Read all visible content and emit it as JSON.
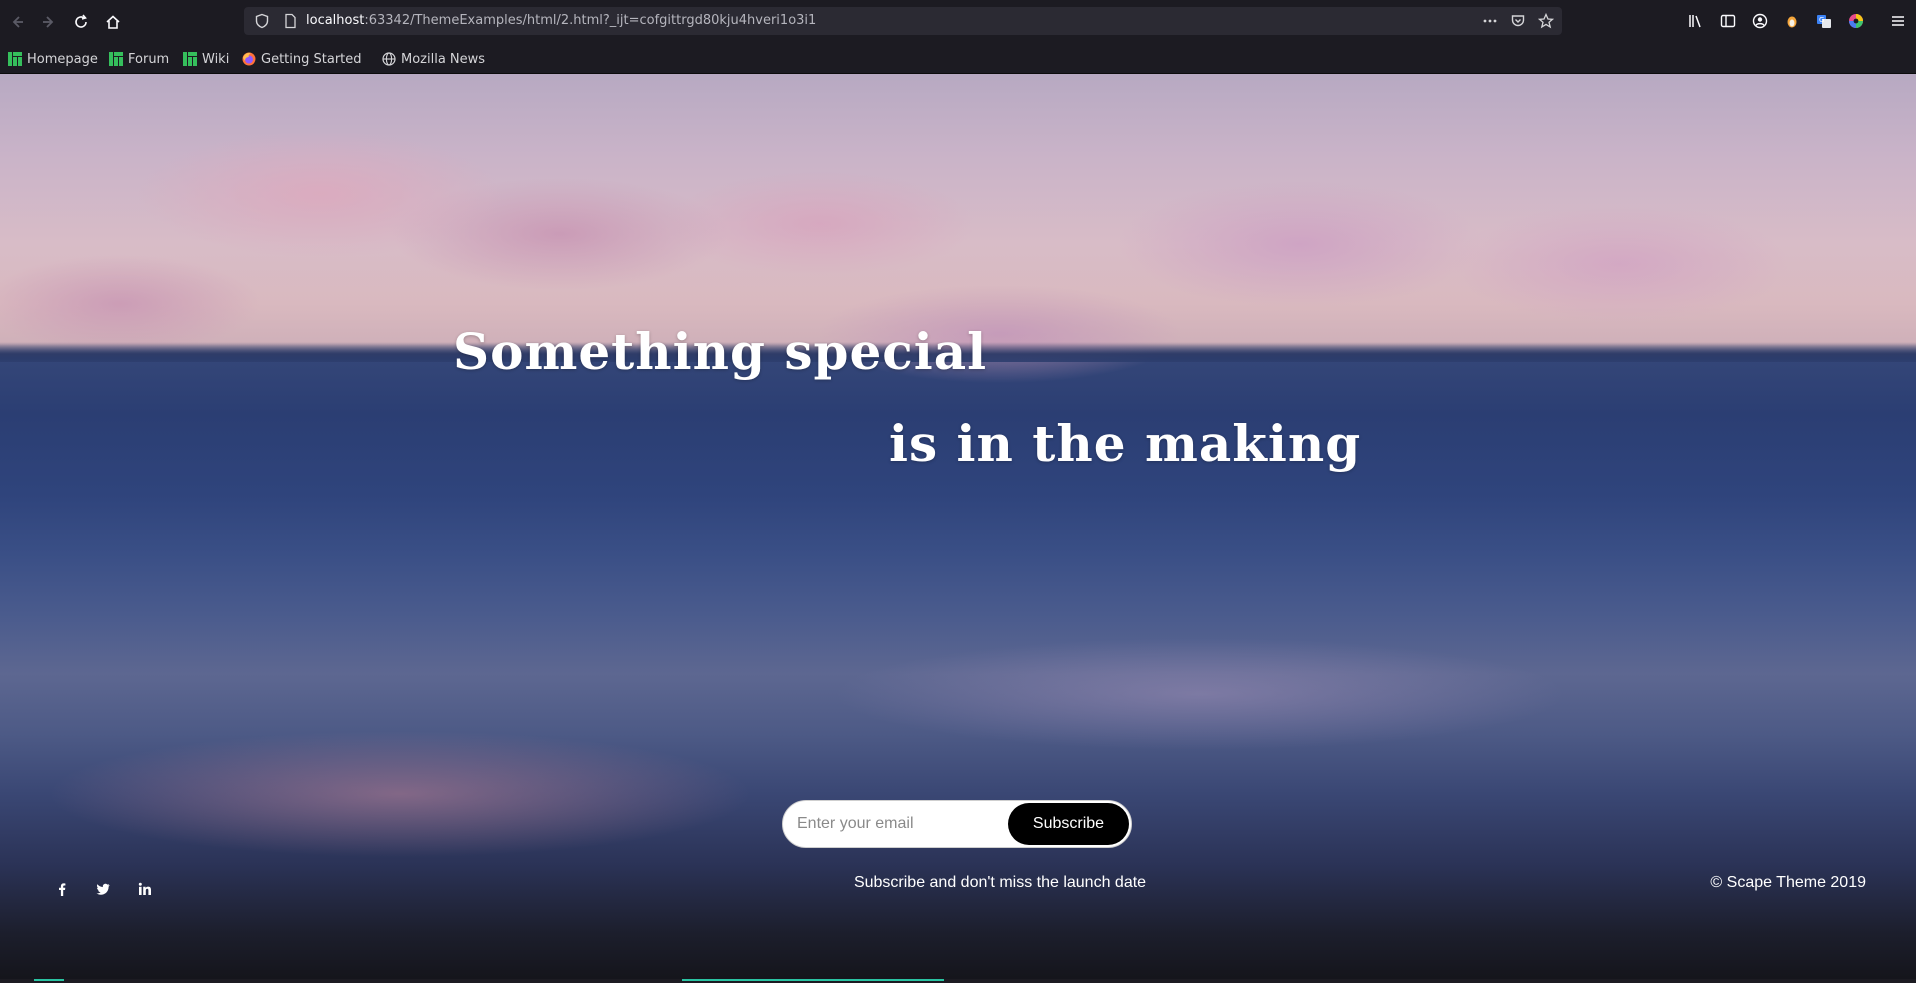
{
  "browser": {
    "url_host": "localhost",
    "url_rest": ":63342/ThemeExamples/html/2.html?_ijt=cofgittrgd80kju4hveri1o3i1",
    "bookmarks": [
      {
        "label": "Homepage",
        "icon": "manjaro-icon"
      },
      {
        "label": "Forum",
        "icon": "manjaro-icon"
      },
      {
        "label": "Wiki",
        "icon": "manjaro-icon"
      },
      {
        "label": "Getting Started",
        "icon": "firefox-icon"
      },
      {
        "label": "Mozilla News",
        "icon": "globe-icon"
      }
    ]
  },
  "hero": {
    "line1": "Something special",
    "line2": "is in the making"
  },
  "subscribe": {
    "placeholder": "Enter your email",
    "button_label": "Subscribe",
    "caption": "Subscribe and don't miss the launch date"
  },
  "footer": {
    "copyright": "© Scape Theme 2019",
    "social": [
      "facebook-icon",
      "twitter-icon",
      "linkedin-icon"
    ]
  },
  "colors": {
    "accent": "#000000",
    "text": "#ffffff"
  }
}
